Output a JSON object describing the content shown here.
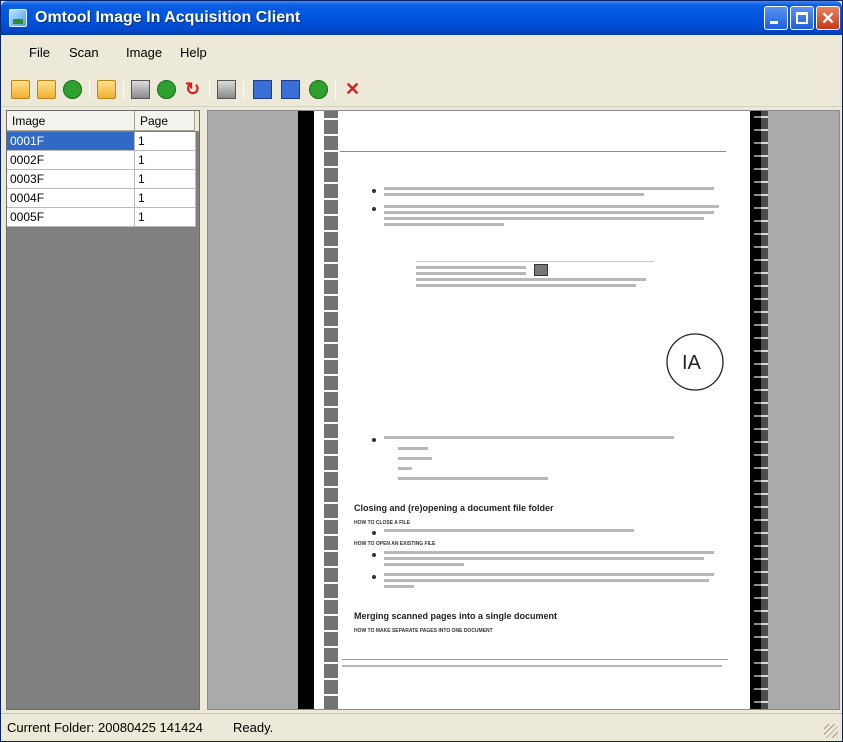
{
  "window": {
    "title": "Omtool Image In Acquisition Client"
  },
  "menu": {
    "items": [
      "File",
      "Scan",
      "Image",
      "Help"
    ]
  },
  "toolbar": {
    "icons": [
      "open-folder-icon",
      "open-scan-folder-icon",
      "refresh-icon",
      "folder-up-icon",
      "scan-icon",
      "rotate-left-icon",
      "rotate-right-icon",
      "scanner-icon",
      "zoom-icon",
      "fit-width-icon",
      "fit-height-icon",
      "next-icon",
      "delete-icon"
    ]
  },
  "grid": {
    "headers": {
      "image": "Image",
      "page": "Page"
    },
    "rows": [
      {
        "image": "0001F",
        "page": "1",
        "selected": true
      },
      {
        "image": "0002F",
        "page": "1",
        "selected": false
      },
      {
        "image": "0003F",
        "page": "1",
        "selected": false
      },
      {
        "image": "0004F",
        "page": "1",
        "selected": false
      },
      {
        "image": "0005F",
        "page": "1",
        "selected": false
      }
    ]
  },
  "document": {
    "heading_1": "Closing and (re)opening a document file folder",
    "heading_2": "Merging scanned pages into a single document",
    "sub_1": "HOW TO CLOSE A FILE",
    "sub_2": "HOW TO OPEN AN EXISTING FILE",
    "sub_3": "HOW TO MAKE SEPARATE PAGES INTO ONE DOCUMENT",
    "handwriting": "IA"
  },
  "status": {
    "folder": "Current Folder: 20080425 141424",
    "state": "Ready."
  }
}
